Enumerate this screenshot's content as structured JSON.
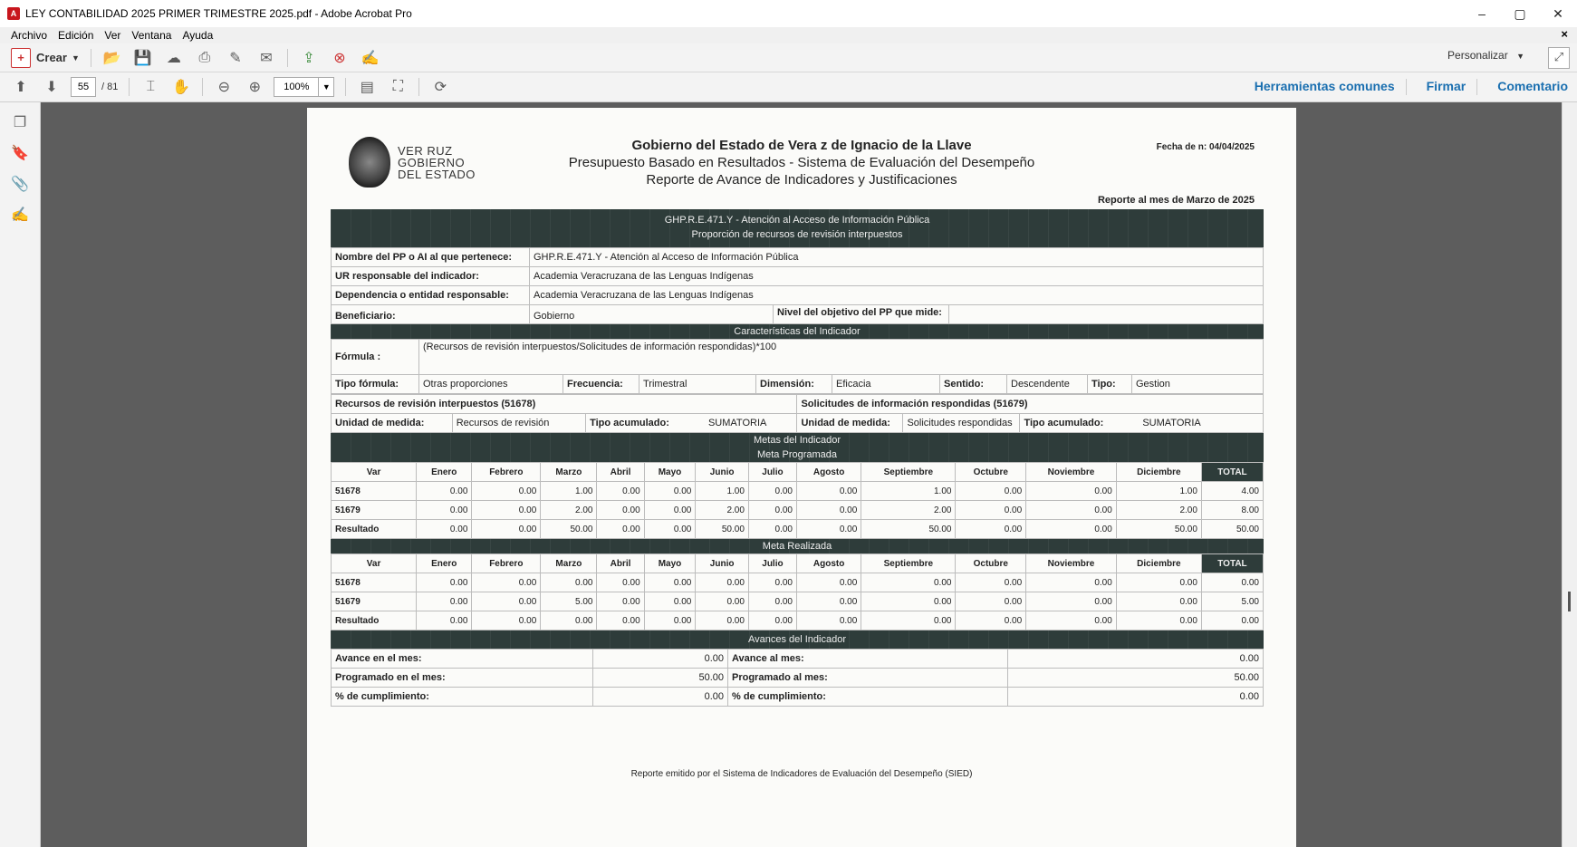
{
  "window": {
    "title": "LEY CONTABILIDAD 2025 PRIMER TRIMESTRE 2025.pdf - Adobe Acrobat Pro",
    "controls": [
      "–",
      "▢",
      "✕"
    ]
  },
  "menu": [
    "Archivo",
    "Edición",
    "Ver",
    "Ventana",
    "Ayuda"
  ],
  "toolbar": {
    "crear": "Crear",
    "personalizar": "Personalizar",
    "page_current": "55",
    "page_total": "/ 81",
    "zoom": "100%",
    "links": [
      "Herramientas comunes",
      "Firmar",
      "Comentario"
    ]
  },
  "doc": {
    "logo": [
      "VER   RUZ",
      "GOBIERNO",
      "DEL ESTADO"
    ],
    "header_1": "Gobierno del Estado de Vera    z de Ignacio de la Llave",
    "header_2": "Presupuesto Basado en Resultados - Sistema de Evaluación del Desempeño",
    "header_3": "Reporte de Avance de Indicadores y Justificaciones",
    "fecha": "Fecha de      n: 04/04/2025",
    "reporte_mes": "Reporte al mes de Marzo de 2025",
    "band_title_1": "GHP.R.E.471.Y - Atención al Acceso de Información Pública",
    "band_title_2": "Proporción de recursos de revisión interpuestos",
    "info": {
      "pp_label": "Nombre del PP o AI al que pertenece:",
      "pp_value": "GHP.R.E.471.Y - Atención al Acceso de Información Pública",
      "ur_label": "UR responsable del indicador:",
      "ur_value": "Academia Veracruzana de las Lenguas Indígenas",
      "dep_label": "Dependencia o entidad responsable:",
      "dep_value": "Academia Veracruzana de las Lenguas Indígenas",
      "nivel_label": "Nivel del objetivo del PP que mide:",
      "nivel_value": "",
      "benef_label": "Beneficiario:",
      "benef_value": "Gobierno"
    },
    "caracteristicas": "Características del Indicador",
    "formula_label": "Fórmula :",
    "formula_value": "(Recursos de revisión interpuestos/Solicitudes de información respondidas)*100",
    "tipo_formula_label": "Tipo fórmula:",
    "tipo_formula_value": "Otras proporciones",
    "frecuencia_label": "Frecuencia:",
    "frecuencia_value": "Trimestral",
    "dimension_label": "Dimensión:",
    "dimension_value": "Eficacia",
    "sentido_label": "Sentido:",
    "sentido_value": "Descendente",
    "tipo_label": "Tipo:",
    "tipo_value": "Gestion",
    "var1_title": "Recursos de revisión interpuestos (51678)",
    "var2_title": "Solicitudes de información respondidas (51679)",
    "unidad_label": "Unidad de medida:",
    "unidad1_value": "Recursos de revisión",
    "unidad2_value": "Solicitudes respondidas",
    "acumulado_label": "Tipo acumulado:",
    "acumulado_value": "SUMATORIA",
    "metas_title": "Metas del Indicador",
    "meta_prog_title": "Meta Programada",
    "meta_real_title": "Meta Realizada",
    "columns": [
      "Var",
      "Enero",
      "Febrero",
      "Marzo",
      "Abril",
      "Mayo",
      "Junio",
      "Julio",
      "Agosto",
      "Septiembre",
      "Octubre",
      "Noviembre",
      "Diciembre",
      "TOTAL"
    ],
    "programada_rows": [
      [
        "51678",
        "0.00",
        "0.00",
        "1.00",
        "0.00",
        "0.00",
        "1.00",
        "0.00",
        "0.00",
        "1.00",
        "0.00",
        "0.00",
        "1.00",
        "4.00"
      ],
      [
        "51679",
        "0.00",
        "0.00",
        "2.00",
        "0.00",
        "0.00",
        "2.00",
        "0.00",
        "0.00",
        "2.00",
        "0.00",
        "0.00",
        "2.00",
        "8.00"
      ],
      [
        "Resultado",
        "0.00",
        "0.00",
        "50.00",
        "0.00",
        "0.00",
        "50.00",
        "0.00",
        "0.00",
        "50.00",
        "0.00",
        "0.00",
        "50.00",
        "50.00"
      ]
    ],
    "realizada_rows": [
      [
        "51678",
        "0.00",
        "0.00",
        "0.00",
        "0.00",
        "0.00",
        "0.00",
        "0.00",
        "0.00",
        "0.00",
        "0.00",
        "0.00",
        "0.00",
        "0.00"
      ],
      [
        "51679",
        "0.00",
        "0.00",
        "5.00",
        "0.00",
        "0.00",
        "0.00",
        "0.00",
        "0.00",
        "0.00",
        "0.00",
        "0.00",
        "0.00",
        "5.00"
      ],
      [
        "Resultado",
        "0.00",
        "0.00",
        "0.00",
        "0.00",
        "0.00",
        "0.00",
        "0.00",
        "0.00",
        "0.00",
        "0.00",
        "0.00",
        "0.00",
        "0.00"
      ]
    ],
    "avances_title": "Avances del Indicador",
    "avance_mes_label": "Avance en el mes:",
    "avance_mes_value": "0.00",
    "prog_mes_label": "Programado en el mes:",
    "prog_mes_value": "50.00",
    "cumpl_label": "% de cumplimiento:",
    "cumpl_mes_value": "0.00",
    "avance_al_label": "Avance al mes:",
    "avance_al_value": "0.00",
    "prog_al_label": "Programado al mes:",
    "prog_al_value": "50.00",
    "cumpl_al_value": "0.00",
    "footer": "Reporte emitido por el Sistema de Indicadores de Evaluación del Desempeño (SIED)"
  }
}
